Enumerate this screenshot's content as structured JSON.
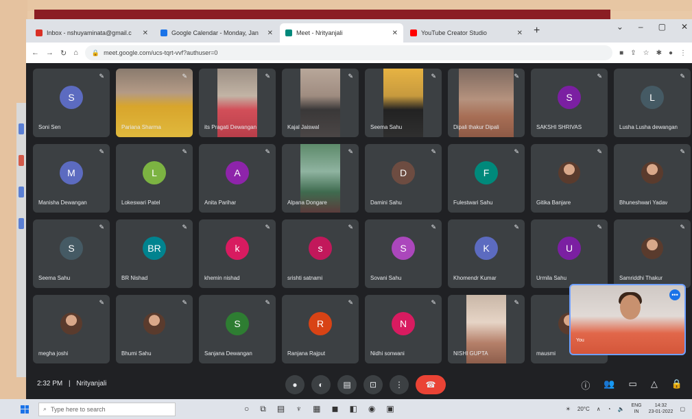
{
  "browser": {
    "tabs": [
      {
        "label": "Inbox - nshuyaminata@gmail.c",
        "color": "#d93025",
        "active": false
      },
      {
        "label": "Google Calendar - Monday, Jan",
        "color": "#1a73e8",
        "active": false
      },
      {
        "label": "Meet - Nrityanjali",
        "color": "#00897b",
        "active": true
      },
      {
        "label": "YouTube Creator Studio",
        "color": "#ff0000",
        "active": false
      }
    ],
    "url": "meet.google.com/ucs-tqrt-vvf?authuser=0",
    "new_tab": "+"
  },
  "participants": [
    {
      "name": "Soni Sen",
      "initial": "S",
      "color": "#5c6bc0",
      "kind": "avatar"
    },
    {
      "name": "Pariana Sharma",
      "kind": "video",
      "v": "v1"
    },
    {
      "name": "its Pragati Dewangan",
      "kind": "video",
      "v": "v2"
    },
    {
      "name": "Kajal Jaiswal",
      "kind": "video",
      "v": "v3"
    },
    {
      "name": "Seema Sahu",
      "kind": "video",
      "v": "v4"
    },
    {
      "name": "Dipali thakur Dipali",
      "kind": "video",
      "v": "v5"
    },
    {
      "name": "SAKSHI SHRIVAS",
      "initial": "S",
      "color": "#7b1fa2",
      "kind": "avatar"
    },
    {
      "name": "Lusha Lusha dewangan",
      "initial": "L",
      "color": "#455a64",
      "kind": "avatar"
    },
    {
      "name": "Manisha Dewangan",
      "initial": "M",
      "color": "#5c6bc0",
      "kind": "avatar"
    },
    {
      "name": "Lokeswari Patel",
      "initial": "L",
      "color": "#7cb342",
      "kind": "avatar"
    },
    {
      "name": "Anita Parihar",
      "initial": "A",
      "color": "#8e24aa",
      "kind": "avatar"
    },
    {
      "name": "Alpana Dongare",
      "kind": "video",
      "v": "v6"
    },
    {
      "name": "Damini Sahu",
      "initial": "D",
      "color": "#6d4c41",
      "kind": "avatar"
    },
    {
      "name": "Fulestwari Sahu",
      "initial": "F",
      "color": "#00897b",
      "kind": "avatar"
    },
    {
      "name": "Gitika Banjare",
      "kind": "photo"
    },
    {
      "name": "Bhuneshwari Yadav",
      "kind": "photo"
    },
    {
      "name": "Seema Sahu",
      "initial": "S",
      "color": "#455a64",
      "kind": "avatar"
    },
    {
      "name": "BR Nishad",
      "initial": "BR",
      "color": "#00838f",
      "kind": "avatar"
    },
    {
      "name": "khemin nishad",
      "initial": "k",
      "color": "#d81b60",
      "kind": "avatar"
    },
    {
      "name": "srishti satnami",
      "initial": "s",
      "color": "#c2185b",
      "kind": "avatar"
    },
    {
      "name": "Sovani Sahu",
      "initial": "S",
      "color": "#ab47bc",
      "kind": "avatar"
    },
    {
      "name": "Khomendr Kumar",
      "initial": "K",
      "color": "#5c6bc0",
      "kind": "avatar"
    },
    {
      "name": "Urmila Sahu",
      "initial": "U",
      "color": "#7b1fa2",
      "kind": "avatar"
    },
    {
      "name": "Samriddhi Thakur",
      "kind": "photo"
    },
    {
      "name": "megha joshi",
      "kind": "photo"
    },
    {
      "name": "Bhumi Sahu",
      "kind": "photo"
    },
    {
      "name": "Sanjana Dewangan",
      "initial": "S",
      "color": "#2e7d32",
      "kind": "avatar"
    },
    {
      "name": "Ranjana Rajput",
      "initial": "R",
      "color": "#d84315",
      "kind": "avatar"
    },
    {
      "name": "Nidhi sonwani",
      "initial": "N",
      "color": "#d81b60",
      "kind": "avatar"
    },
    {
      "name": "NISHI GUPTA",
      "kind": "video",
      "v": "v7"
    },
    {
      "name": "mausmi",
      "kind": "photo"
    }
  ],
  "self_view": {
    "label": "You",
    "badge": "•••"
  },
  "meeting": {
    "time": "2:32 PM",
    "separator": "|",
    "name": "Nrityanjali"
  },
  "controls": {
    "mic": "●",
    "cam": "◐",
    "cc": "▤",
    "present": "⊡",
    "more": "⋮",
    "end": "☎"
  },
  "taskbar": {
    "search_placeholder": "Type here to search",
    "weather": "20°C",
    "lang_top": "ENG",
    "lang_bottom": "IN",
    "time": "14:32",
    "date": "23-01-2022"
  }
}
